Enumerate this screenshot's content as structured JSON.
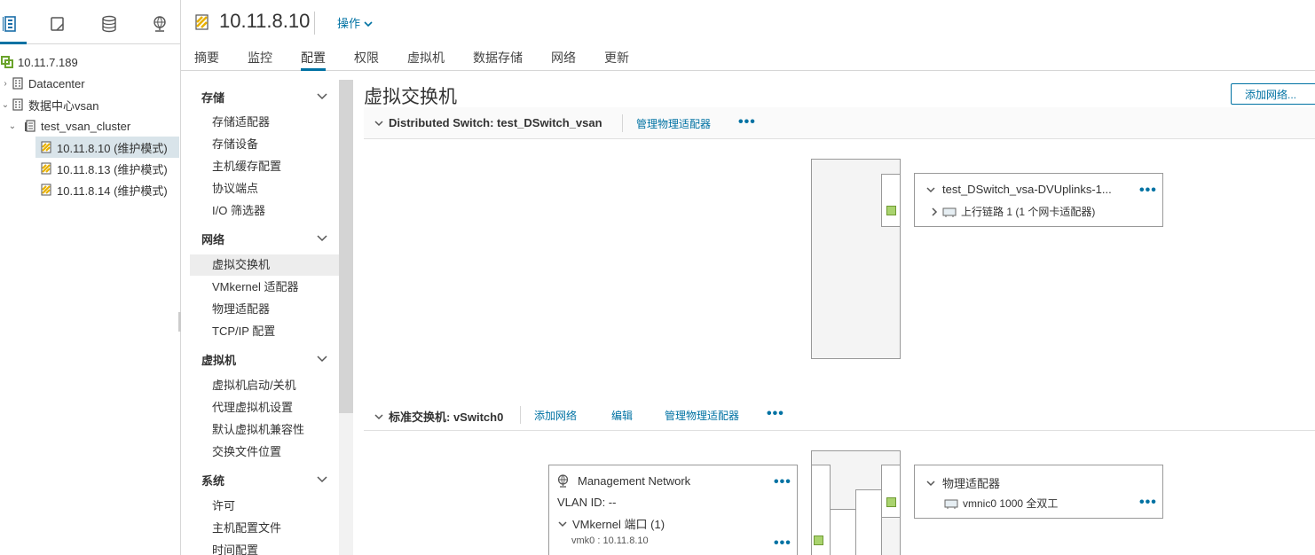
{
  "navigator": {
    "tabs": [
      "hosts-and-clusters-icon",
      "vms-and-templates-icon",
      "storage-icon",
      "networking-icon"
    ],
    "tree": [
      {
        "label": "10.11.7.189",
        "icon": "vcenter-icon"
      },
      {
        "label": "Datacenter",
        "icon": "datacenter-icon"
      },
      {
        "label": "数据中心vsan",
        "icon": "datacenter-icon"
      },
      {
        "label": "test_vsan_cluster",
        "icon": "cluster-icon"
      },
      {
        "label": "10.11.8.10 (维护模式)",
        "icon": "host-maintenance-icon"
      },
      {
        "label": "10.11.8.13 (维护模式)",
        "icon": "host-maintenance-icon"
      },
      {
        "label": "10.11.8.14 (维护模式)",
        "icon": "host-maintenance-icon"
      }
    ]
  },
  "header": {
    "title": "10.11.8.10",
    "actions_label": "操作",
    "tabs": [
      "摘要",
      "监控",
      "配置",
      "权限",
      "虚拟机",
      "数据存储",
      "网络",
      "更新"
    ],
    "active_tab": "配置"
  },
  "config_menu": {
    "groups": [
      {
        "label": "存储",
        "items": [
          "存储适配器",
          "存储设备",
          "主机缓存配置",
          "协议端点",
          "I/O 筛选器"
        ]
      },
      {
        "label": "网络",
        "items": [
          "虚拟交换机",
          "VMkernel 适配器",
          "物理适配器",
          "TCP/IP 配置"
        ]
      },
      {
        "label": "虚拟机",
        "items": [
          "虚拟机启动/关机",
          "代理虚拟机设置",
          "默认虚拟机兼容性",
          "交换文件位置"
        ]
      },
      {
        "label": "系统",
        "items": [
          "许可",
          "主机配置文件",
          "时间配置"
        ]
      }
    ],
    "active_item": "虚拟交换机"
  },
  "content": {
    "title": "虚拟交换机",
    "add_network_label": "添加网络...",
    "dswitch": {
      "name": "Distributed Switch: test_DSwitch_vsan",
      "manage_label": "管理物理适配器",
      "uplink_group": "test_DSwitch_vsa-DVUplinks-1...",
      "uplink": "上行链路 1 (1 个网卡适配器)"
    },
    "vswitch": {
      "name": "标准交换机: vSwitch0",
      "add_network_label": "添加网络",
      "edit_label": "编辑",
      "manage_label": "管理物理适配器",
      "portgroup": {
        "name": "Management Network",
        "vlan": "VLAN ID: --",
        "vmk_group": "VMkernel 端口 (1)",
        "vmk": "vmk0 : 10.11.8.10"
      },
      "physical_group": "物理适配器",
      "nic": "vmnic0 1000 全双工"
    }
  },
  "colors": {
    "accent": "#0072a3",
    "port_green": "#a9d36e",
    "host_maint": "#e8b000"
  }
}
